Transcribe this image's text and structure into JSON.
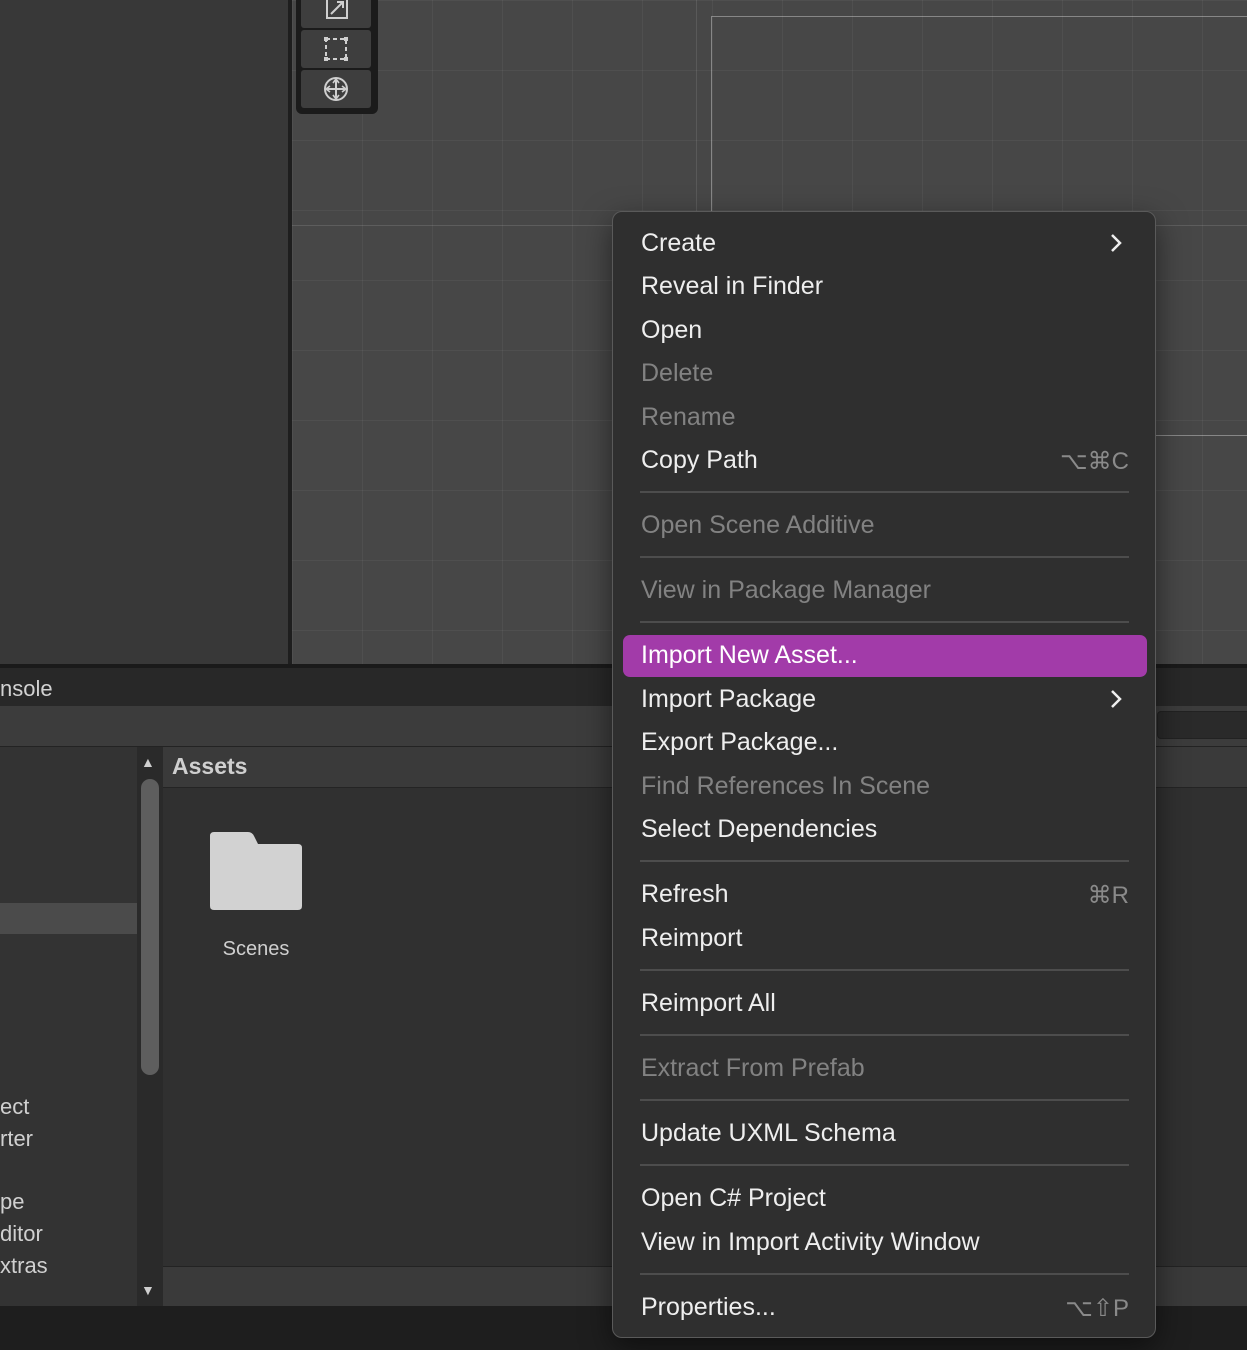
{
  "console_tab": {
    "label": "nsole"
  },
  "project": {
    "tree_items": [
      "ect",
      "rter",
      "pe",
      "ditor",
      "xtras"
    ],
    "breadcrumb": "Assets",
    "assets": [
      {
        "name": "Scenes",
        "icon": "folder-icon"
      }
    ]
  },
  "context_menu": {
    "highlight_color": "#a23ba9",
    "items": [
      {
        "label": "Create",
        "submenu": true
      },
      {
        "label": "Reveal in Finder"
      },
      {
        "label": "Open"
      },
      {
        "label": "Delete",
        "disabled": true
      },
      {
        "label": "Rename",
        "disabled": true
      },
      {
        "label": "Copy Path",
        "shortcut": "⌥⌘C"
      },
      {
        "label": "Open Scene Additive",
        "disabled": true
      },
      {
        "label": "View in Package Manager",
        "disabled": true
      },
      {
        "label": "Import New Asset...",
        "highlighted": true
      },
      {
        "label": "Import Package",
        "submenu": true
      },
      {
        "label": "Export Package..."
      },
      {
        "label": "Find References In Scene",
        "disabled": true
      },
      {
        "label": "Select Dependencies"
      },
      {
        "label": "Refresh",
        "shortcut": "⌘R"
      },
      {
        "label": "Reimport"
      },
      {
        "label": "Reimport All"
      },
      {
        "label": "Extract From Prefab",
        "disabled": true
      },
      {
        "label": "Update UXML Schema"
      },
      {
        "label": "Open C# Project"
      },
      {
        "label": "View in Import Activity Window"
      },
      {
        "label": "Properties...",
        "shortcut": "⌥⇧P"
      }
    ]
  }
}
